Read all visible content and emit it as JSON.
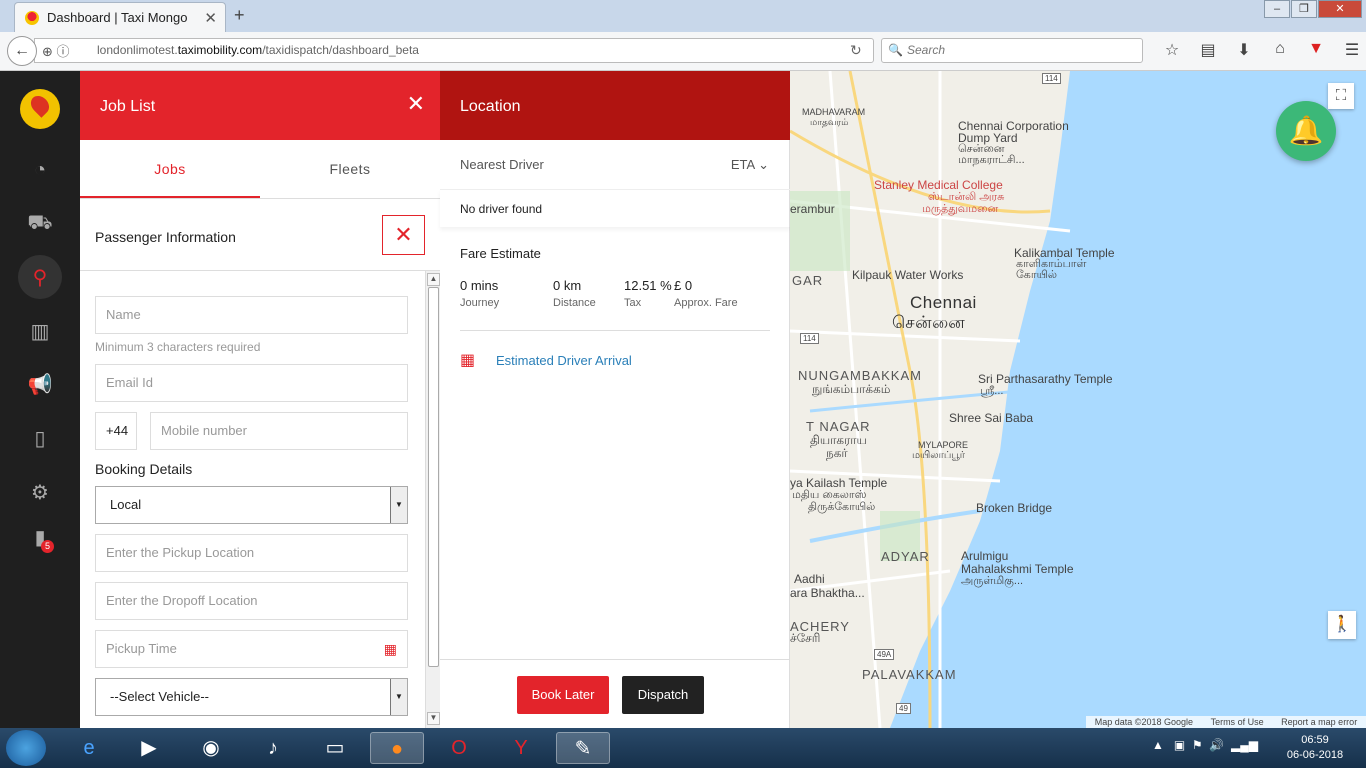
{
  "browser": {
    "tab_title": "Dashboard | Taxi Mongo",
    "url_prefix": "londonlimotest.",
    "url_domain": "taximobility.com",
    "url_path": "/taxidispatch/dashboard_beta",
    "search_placeholder": "Search"
  },
  "sidebar": {
    "badge_count": "5"
  },
  "joblist": {
    "title": "Job List",
    "tabs": [
      "Jobs",
      "Fleets"
    ],
    "passenger_title": "Passenger Information",
    "name_placeholder": "Name",
    "name_hint": "Minimum 3 characters required",
    "email_placeholder": "Email Id",
    "country_code": "+44",
    "mobile_placeholder": "Mobile number",
    "booking_title": "Booking Details",
    "booking_type": "Local",
    "pickup_placeholder": "Enter the Pickup Location",
    "dropoff_placeholder": "Enter the Dropoff Location",
    "pickup_time_placeholder": "Pickup Time",
    "vehicle_select": "--Select Vehicle--"
  },
  "location": {
    "title": "Location",
    "nearest_driver": "Nearest Driver",
    "eta": "ETA",
    "no_driver": "No driver found",
    "fare_title": "Fare Estimate",
    "fare": [
      {
        "value": "0 mins",
        "label": "Journey"
      },
      {
        "value": "0 km",
        "label": "Distance"
      },
      {
        "value": "12.51 %",
        "label": "Tax"
      },
      {
        "value": "£ 0",
        "label": "Approx. Fare"
      }
    ],
    "arrival_link": "Estimated Driver Arrival",
    "book_later": "Book Later",
    "dispatch": "Dispatch"
  },
  "map": {
    "labels": {
      "madhavaram": "MADHAVARAM",
      "madhavaram_ta": "மாதவரம்",
      "dump_yard": "Chennai Corporation",
      "dump_yard2": "Dump Yard",
      "dump_yard_ta": "சென்னை",
      "dump_yard_ta2": "மாநகராட்சி...",
      "stanley": "Stanley Medical College",
      "stanley_ta": "ஸ்டான்லி அரசு",
      "stanley_ta2": "மருத்துவமனை",
      "perambur": "erambur",
      "kalikambal": "Kalikambal Temple",
      "kalikambal_ta": "காளிகாம்பாள்",
      "kalikambal_ta2": "கோயில்",
      "kilpauk": "Kilpauk Water Works",
      "gar": "GAR",
      "chennai": "Chennai",
      "chennai_ta": "சென்னை",
      "nungambakkam": "NUNGAMBAKKAM",
      "nungambakkam_ta": "நுங்கம்பாக்கம்",
      "parthasarathy": "Sri Parthasarathy Temple",
      "parthasarathy_ta": "ஸ்ரீ...",
      "shree_sai": "Shree Sai Baba",
      "tnagar": "T NAGAR",
      "tnagar_ta": "தியாகராய",
      "tnagar_ta2": "நகர்",
      "mylapore": "MYLAPORE",
      "mylapore_ta": "மயிலாப்பூர்",
      "kailash": "ya Kailash Temple",
      "kailash_ta": "மதிய கைலாஸ்",
      "kailash_ta2": "திருக்கோயில்",
      "broken_bridge": "Broken Bridge",
      "adyar": "ADYAR",
      "arulmigu": "Arulmigu",
      "arulmigu2": "Mahalakshmi Temple",
      "arulmigu_ta": "அருள்மிகு...",
      "aadhi": "Aadhi",
      "aadhi2": "ara Bhaktha...",
      "achery": "ACHERY",
      "achery_ta": "ச்சேரி",
      "palavakkam": "PALAVAKKAM",
      "r114a": "114",
      "r114b": "114",
      "r49a": "49A",
      "r49": "49"
    },
    "attribution": "Map data ©2018 Google",
    "terms": "Terms of Use",
    "report": "Report a map error"
  },
  "taskbar": {
    "time": "06:59",
    "date": "06-06-2018"
  }
}
